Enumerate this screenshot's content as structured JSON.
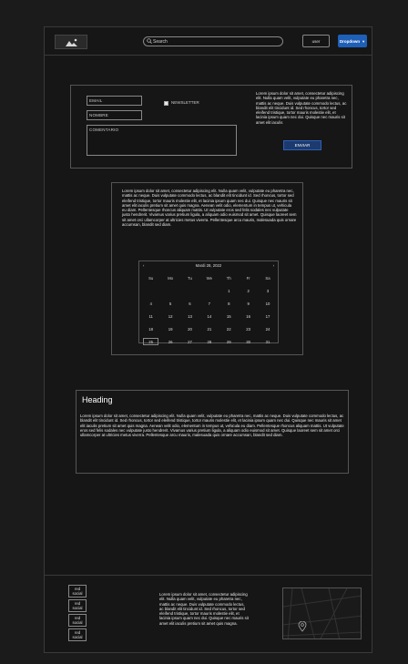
{
  "header": {
    "search_placeholder": "Search",
    "user_label": "user",
    "dropdown_label": "Dropdown"
  },
  "form": {
    "email_label": "EMAIL",
    "name_label": "NOMBRE",
    "comment_label": "COMENTARIO",
    "newsletter_label": "NEWSLETTER",
    "newsletter_checked": false,
    "side_text": "Lorem ipsum dolor sit amet, consectetur adipiscing elit. Nulla quam velit, vulputate eu pharetra nec, mattis ac neque. Duis vulputate commodo lectus, ac blandit elit tincidunt id. Sed rhoncus, tortor sed eleifend tristique, tortor mauris molestie elit, et lacinia ipsum quam nec dui. Quisque nec mauris sit amet elit iaculis",
    "send_label": "ENVIAR"
  },
  "middle": {
    "text": "Lorem ipsum dolor sit amet, consectetur adipiscing elit. Nulla quam velit, vulputate eu pharetra nec, mattis ac neque. Duis vulputate commodo lectus, ac blandit elit tincidunt id. Sed rhoncus, tortor sed eleifend tristique, tortor mauris molestie elit, et lacinia ipsum quam nec dui. Quisque nec mauris sit amet elit iaculis pretium sit amet quis magna. Aenean velit odio, elementum in tempus ut, vehicula eu diam. Pellentesque rhoncus aliquam mattis. Ut vulputate eros sed felis sodales nec vulputate justo hendrerit. Vivamus varius pretium ligula, a aliquam odio euismod sit amet. Quisque laoreet sem sit amet orci ullamcorper at ultricies metus viverra. Pellentesque arcu mauris, malesuada quis ornare accumsan, blandit sed diam."
  },
  "calendar": {
    "title": "Mardi 28, 2022",
    "prev": "‹",
    "next": "›",
    "weekdays": [
      "Su",
      "Mo",
      "Tu",
      "We",
      "Th",
      "Fr",
      "Sa"
    ],
    "days": [
      "",
      "",
      "",
      "",
      "1",
      "2",
      "3",
      "4",
      "5",
      "6",
      "7",
      "8",
      "9",
      "10",
      "11",
      "12",
      "13",
      "14",
      "15",
      "16",
      "17",
      "18",
      "19",
      "20",
      "21",
      "22",
      "23",
      "24",
      "25",
      "26",
      "27",
      "28",
      "29",
      "30",
      "31",
      ""
    ],
    "selected": "25"
  },
  "content": {
    "heading": "Heading",
    "text": "Lorem ipsum dolor sit amet, consectetur adipiscing elit. Nulla quam velit, vulputate eu pharetra nec, mattis ac neque. Duis vulputate commodo lectus, ac blandit elit tincidunt id. Sed rhoncus, tortor sed eleifend tristique, tortor mauris molestie elit, et lacinia ipsum quam nec dui. Quisque nec mauris sit amet elit iaculis pretium sit amet quis magna. Aenean velit odio, elementum in tempus ut, vehicula eu diam. Pellentesque rhoncus aliquam mattis. Ut vulputate eros sed felis sodales nec vulputate justo hendrerit. Vivamus varius pretium ligula, a aliquam odio euismod sit amet. Quisque laoreet sem sit amet orci ullamcorper at ultricies metus viverra. Pellentesque arcu mauris, malesuada quis ornare accumsan, blandit sed diam."
  },
  "footer": {
    "social": [
      "red social",
      "red social",
      "red social",
      "red social"
    ],
    "text": "Lorem ipsum dolor sit amet, consectetur adipiscing elit. Nulla quam velit, vulputate eu pharetra nec, mattis ac neque. Duis vulputate commodo lectus, ac blandit elit tincidunt id. Sed rhoncus, tortor sed eleifend tristique, tortor mauris molestie elit, et lacinia ipsum quam nec dui. Quisque nec mauris sit amet elit iaculis pretium sit amet quis magna."
  },
  "colors": {
    "background": "#161616",
    "accent": "#1e5fb8",
    "button": "#1c3a6e"
  },
  "icons": {
    "logo": "image-placeholder-icon",
    "search": "search-icon",
    "dropdown": "caret-down-icon",
    "map": "map-pin-icon"
  }
}
